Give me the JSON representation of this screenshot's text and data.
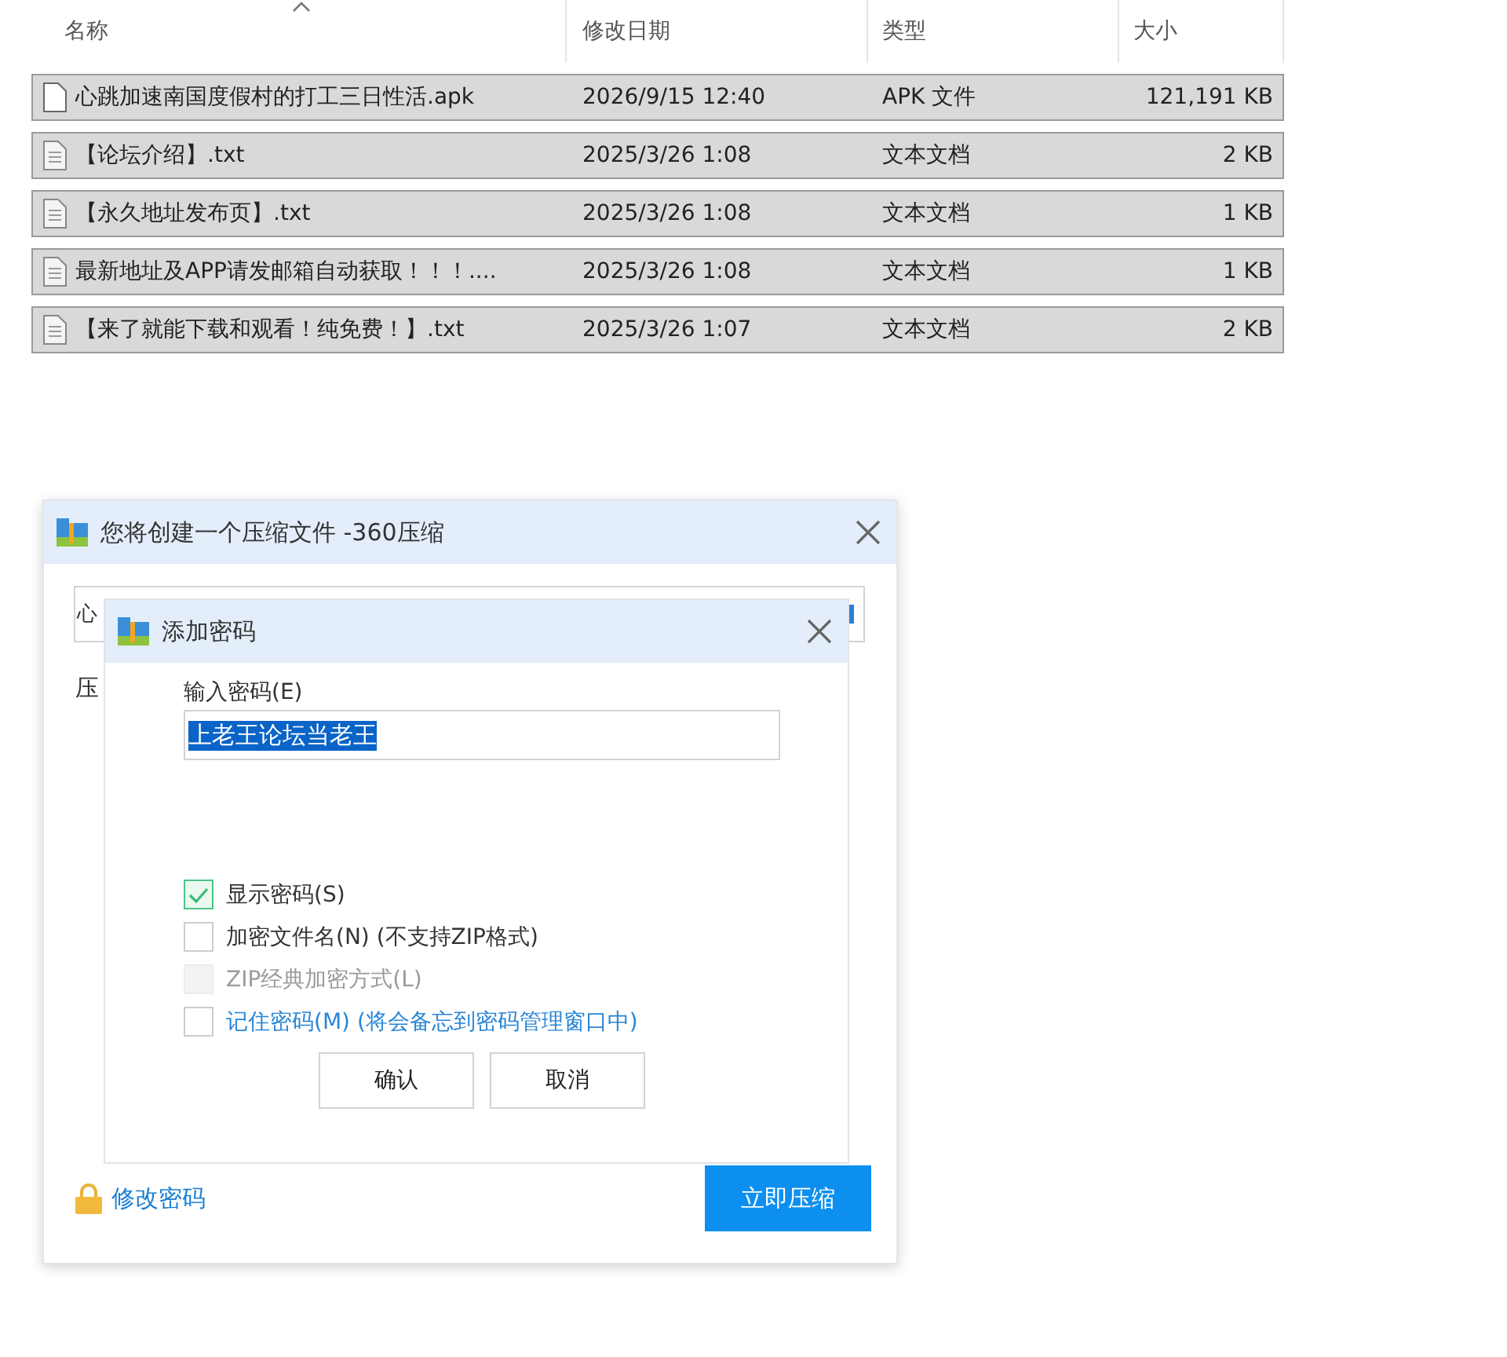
{
  "file_list": {
    "columns": [
      {
        "label": "名称",
        "sorted": true
      },
      {
        "label": "修改日期",
        "sorted": false
      },
      {
        "label": "类型",
        "sorted": false
      },
      {
        "label": "大小",
        "sorted": false
      }
    ],
    "rows": [
      {
        "name": "心跳加速南国度假村的打工三日性活.apk",
        "modified": "2026/9/15 12:40",
        "type": "APK 文件",
        "size": "121,191 KB",
        "kind": "apk",
        "selected": true
      },
      {
        "name": "【论坛介绍】.txt",
        "modified": "2025/3/26 1:08",
        "type": "文本文档",
        "size": "2 KB",
        "kind": "txt",
        "selected": true
      },
      {
        "name": "【永久地址发布页】.txt",
        "modified": "2025/3/26 1:08",
        "type": "文本文档",
        "size": "1 KB",
        "kind": "txt",
        "selected": true
      },
      {
        "name": "最新地址及APP请发邮箱自动获取！！！....",
        "modified": "2025/3/26 1:08",
        "type": "文本文档",
        "size": "1 KB",
        "kind": "txt",
        "selected": true
      },
      {
        "name": "【来了就能下载和观看！纯免费！】.txt",
        "modified": "2025/3/26 1:07",
        "type": "文本文档",
        "size": "2 KB",
        "kind": "txt",
        "selected": true
      }
    ]
  },
  "compress_dialog": {
    "title": "您将创建一个压缩文件 -360压缩",
    "path_value": "心",
    "label": "压",
    "change_password_link": "修改密码",
    "compress_button": "立即压缩"
  },
  "password_dialog": {
    "title": "添加密码",
    "password_label": "输入密码(E)",
    "password_value": "上老王论坛当老王",
    "value_selected": true,
    "options": [
      {
        "label": "显示密码(S)",
        "checked": true,
        "disabled": false,
        "kind": "plain"
      },
      {
        "label": "加密文件名(N) (不支持ZIP格式)",
        "checked": false,
        "disabled": false,
        "kind": "plain"
      },
      {
        "label": "ZIP经典加密方式(L)",
        "checked": false,
        "disabled": true,
        "kind": "plain"
      },
      {
        "label": "记住密码(M) (将会备忘到密码管理窗口中)",
        "checked": false,
        "disabled": false,
        "kind": "link"
      }
    ],
    "buttons": [
      "确认",
      "取消"
    ]
  }
}
